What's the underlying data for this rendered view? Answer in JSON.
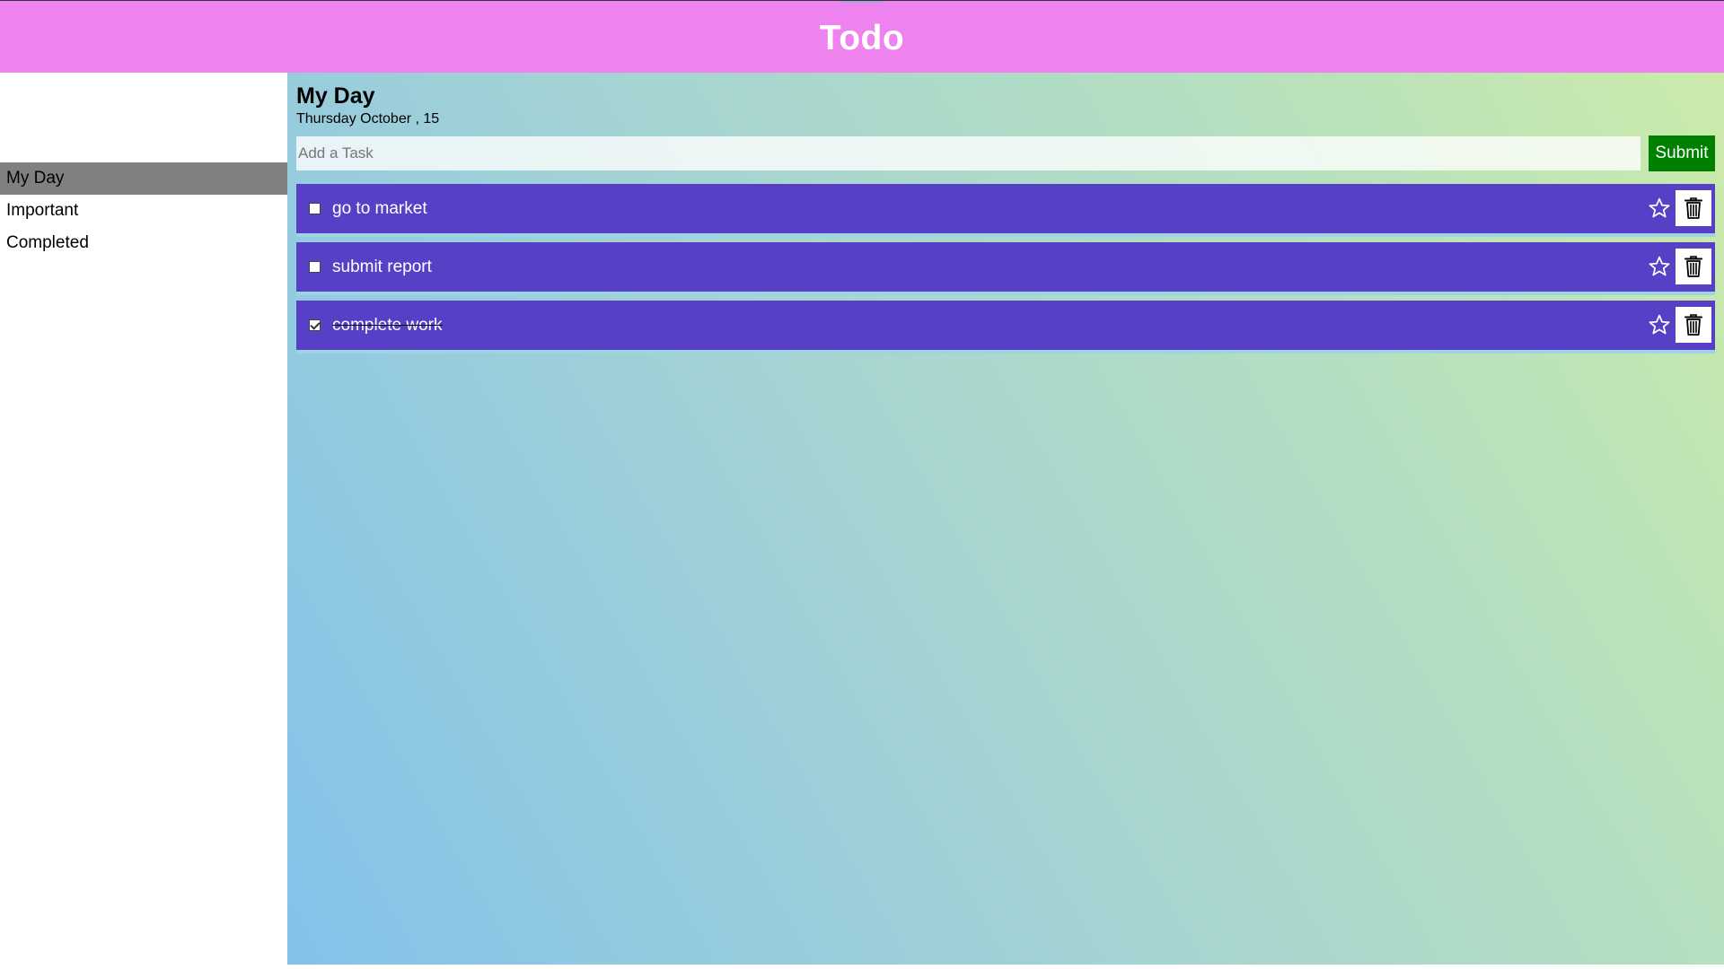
{
  "header": {
    "title": "Todo",
    "background_color": "#ee82ee"
  },
  "sidebar": {
    "items": [
      {
        "label": "My Day",
        "active": true
      },
      {
        "label": "Important",
        "active": false
      },
      {
        "label": "Completed",
        "active": false
      }
    ],
    "active_color": "#808080"
  },
  "main": {
    "title": "My Day",
    "date": "Thursday October , 15"
  },
  "form": {
    "value": "",
    "placeholder": "Add a Task",
    "submit_label": "Submit",
    "submit_color": "#008000"
  },
  "tasks": [
    {
      "text": "go to market",
      "completed": false,
      "important": false
    },
    {
      "text": "submit report",
      "completed": false,
      "important": false
    },
    {
      "text": "complete work",
      "completed": true,
      "important": false
    }
  ],
  "colors": {
    "task_background": "#5840c6"
  },
  "icons": {
    "star": "star-icon",
    "delete": "trash-icon"
  }
}
